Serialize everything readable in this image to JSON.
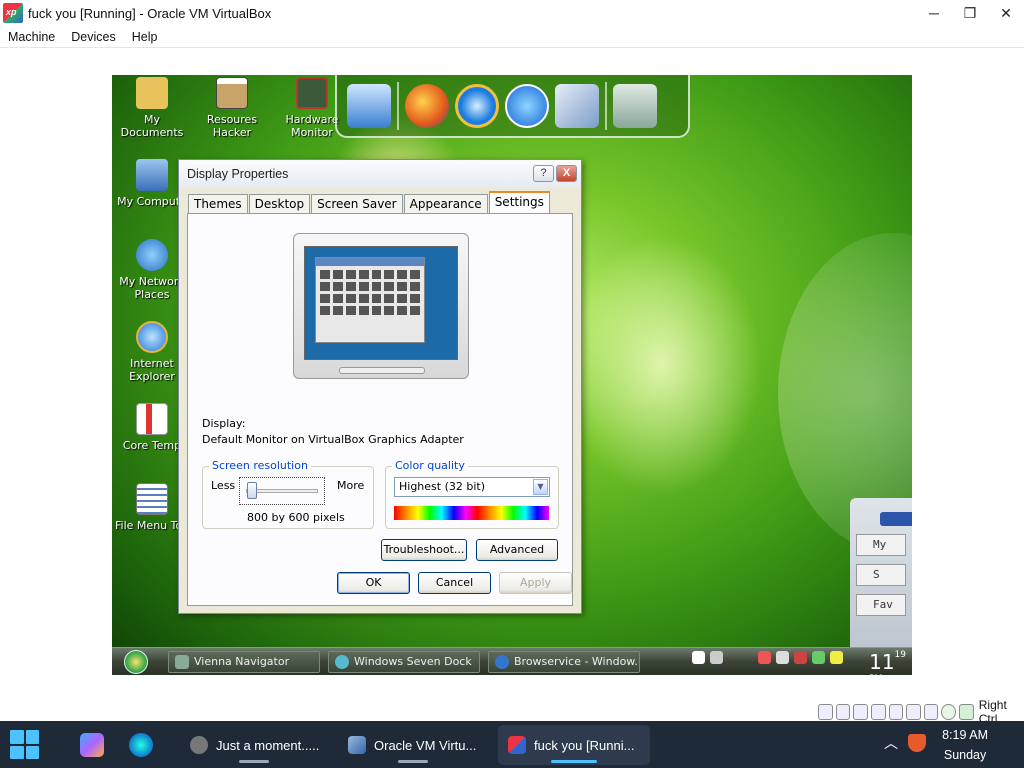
{
  "host": {
    "title": "fuck you [Running] - Oracle VM VirtualBox",
    "app_icon_text": "xp",
    "menu": [
      "Machine",
      "Devices",
      "Help"
    ],
    "status_right_label": "Right Ctrl"
  },
  "desktop": {
    "icons": [
      {
        "label": "My Documents",
        "color": "#e8c25a"
      },
      {
        "label": "Resoures Hacker",
        "color": "#c9a46a"
      },
      {
        "label": "Hardware Monitor",
        "color": "#b8372e"
      },
      {
        "label": "My Compute",
        "color": "#6fa0e0"
      },
      {
        "label": "My Network Places",
        "color": "#5a8fd6"
      },
      {
        "label": "Internet Explorer",
        "color": "#3c88e0"
      },
      {
        "label": "Core Temp",
        "color": "#d0d0d0"
      },
      {
        "label": "File Menu Too",
        "color": "#e0e6f0"
      }
    ],
    "side_panel_buttons": [
      "My",
      "S",
      "Fav"
    ]
  },
  "dialog": {
    "title": "Display Properties",
    "help_glyph": "?",
    "close_glyph": "X",
    "tabs": [
      "Themes",
      "Desktop",
      "Screen Saver",
      "Appearance",
      "Settings"
    ],
    "active_tab": "Settings",
    "display_label": "Display:",
    "display_value": "Default Monitor on VirtualBox Graphics Adapter",
    "resolution": {
      "title": "Screen resolution",
      "less": "Less",
      "more": "More",
      "value_text": "800 by 600 pixels",
      "slider_position": 0
    },
    "color_quality": {
      "title": "Color quality",
      "selected": "Highest (32 bit)"
    },
    "buttons": {
      "troubleshoot": "Troubleshoot...",
      "advanced": "Advanced",
      "ok": "OK",
      "cancel": "Cancel",
      "apply": "Apply"
    }
  },
  "guest_taskbar": {
    "tasks": [
      "Vienna Navigator",
      "Windows Seven Dock",
      "Browservice - Window..."
    ],
    "clock": "11",
    "clock_small": "19",
    "clock_ampm": "PM"
  },
  "win_taskbar": {
    "tasks": [
      "Just a moment.....",
      "Oracle VM Virtu...",
      "fuck you [Runni..."
    ],
    "active_task": "fuck you [Runni...",
    "time": "8:19 AM",
    "day": "Sunday"
  }
}
